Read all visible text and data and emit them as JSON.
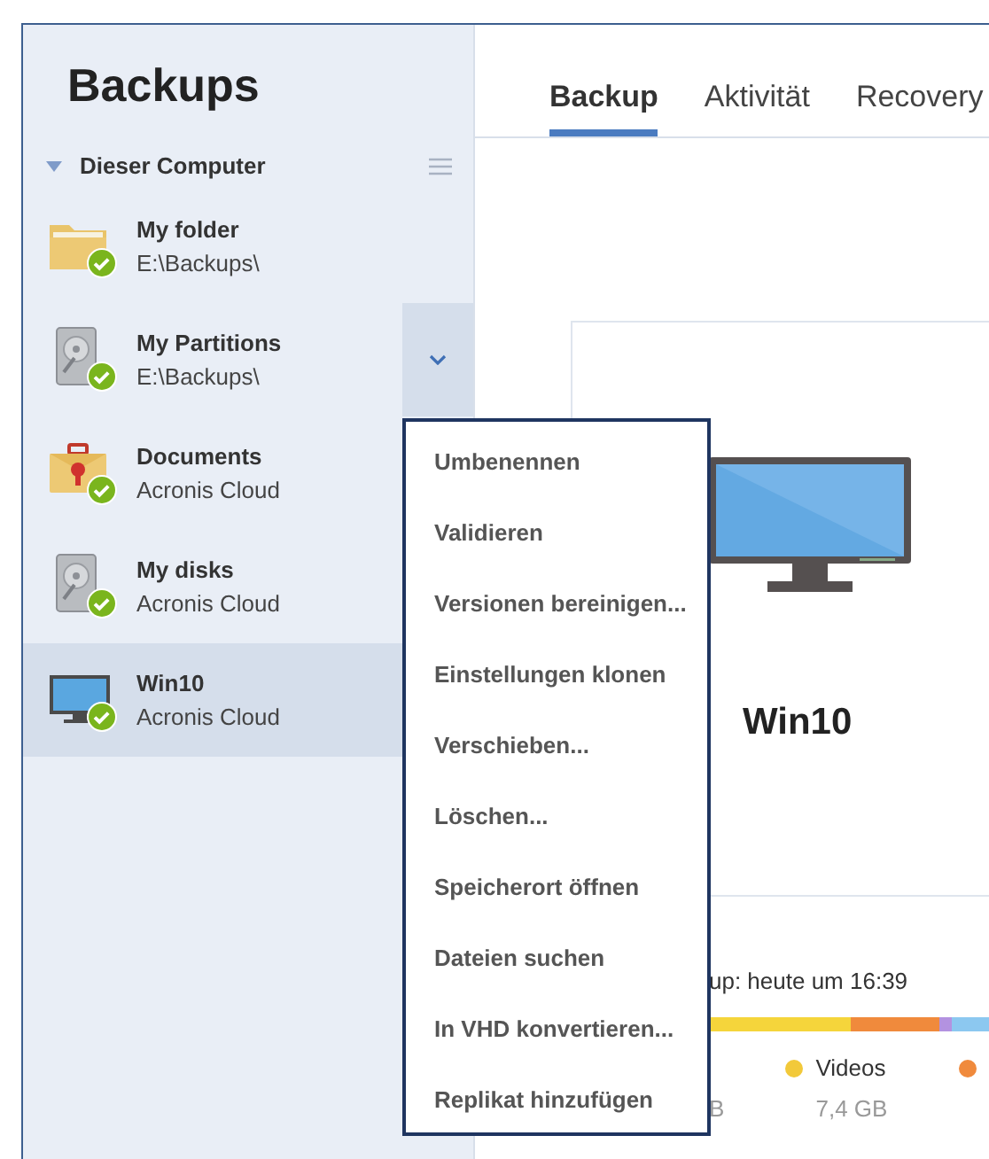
{
  "sidebar": {
    "title": "Backups",
    "group": {
      "label": "Dieser Computer",
      "expanded": true
    },
    "items": [
      {
        "kind": "folder",
        "name": "My folder",
        "location": "E:\\Backups\\",
        "selected": false,
        "hovered": false
      },
      {
        "kind": "disk",
        "name": "My Partitions",
        "location": "E:\\Backups\\",
        "selected": false,
        "hovered": true
      },
      {
        "kind": "briefcase",
        "name": "Documents",
        "location": "Acronis Cloud",
        "selected": false,
        "hovered": false
      },
      {
        "kind": "disk",
        "name": "My disks",
        "location": "Acronis Cloud",
        "selected": false,
        "hovered": false
      },
      {
        "kind": "monitor",
        "name": "Win10",
        "location": "Acronis Cloud",
        "selected": true,
        "hovered": false
      }
    ]
  },
  "tabs": [
    {
      "label": "Backup",
      "selected": true
    },
    {
      "label": "Aktivität",
      "selected": false
    },
    {
      "label": "Recovery",
      "selected": false
    }
  ],
  "card": {
    "name": "Win10"
  },
  "summary": {
    "last_backup": "up: heute um 16:39",
    "legend": [
      {
        "size": "B"
      },
      {
        "name": "Videos",
        "size": "7,4 GB",
        "color": "#f2c93a"
      },
      {
        "color": "#f08a3c"
      }
    ]
  },
  "context_menu": [
    "Umbenennen",
    "Validieren",
    "Versionen bereinigen...",
    "Einstellungen klonen",
    "Verschieben...",
    "Löschen...",
    "Speicherort öffnen",
    "Dateien suchen",
    "In VHD konvertieren...",
    "Replikat hinzufügen"
  ]
}
